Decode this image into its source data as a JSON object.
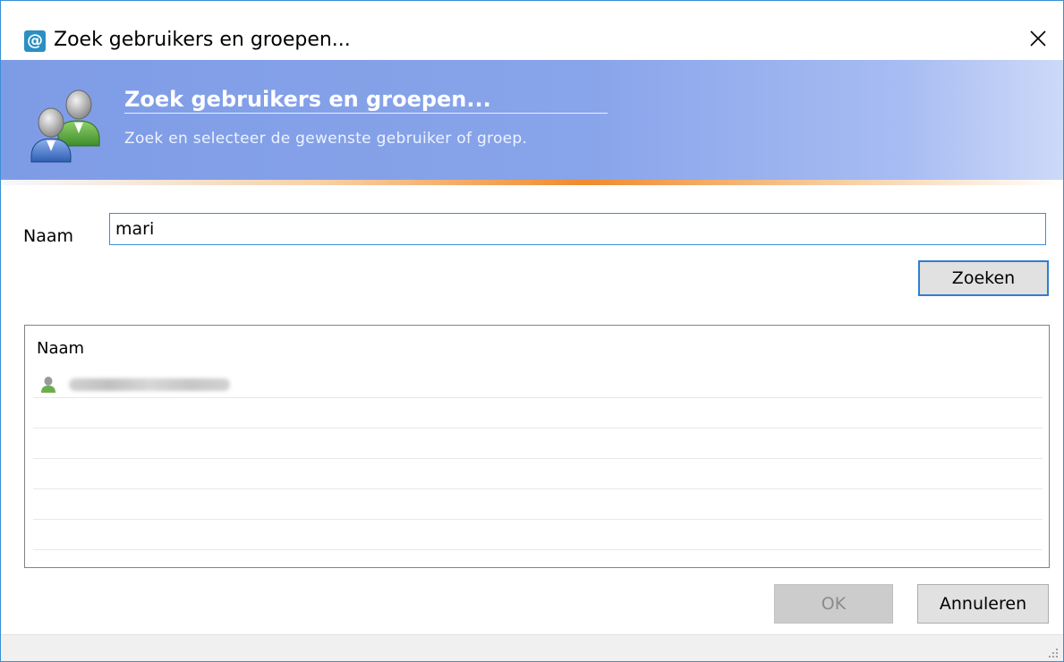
{
  "window": {
    "title": "Zoek gebruikers en groepen...",
    "close_symbol": "✕"
  },
  "app_icon": {
    "glyph": "@",
    "icon": "at-sign-icon",
    "color": "#2b8fc2"
  },
  "banner": {
    "title": "Zoek gebruikers en groepen...",
    "subtitle": "Zoek en selecteer de gewenste gebruiker of groep.",
    "icon": "users-group-icon",
    "colors": {
      "gradient_start": "#7e9ce6",
      "gradient_end": "#cdd9f8",
      "accent_line": "#f08b2e"
    }
  },
  "form": {
    "name_label": "Naam",
    "name_value": "mari",
    "search_button": "Zoeken"
  },
  "results": {
    "column_header": "Naam",
    "rows": [
      {
        "icon": "user-icon",
        "name_blurred": true
      }
    ]
  },
  "footer": {
    "ok_label": "OK",
    "ok_enabled": false,
    "cancel_label": "Annuleren"
  },
  "colors": {
    "focus_border": "#3b8ede"
  }
}
